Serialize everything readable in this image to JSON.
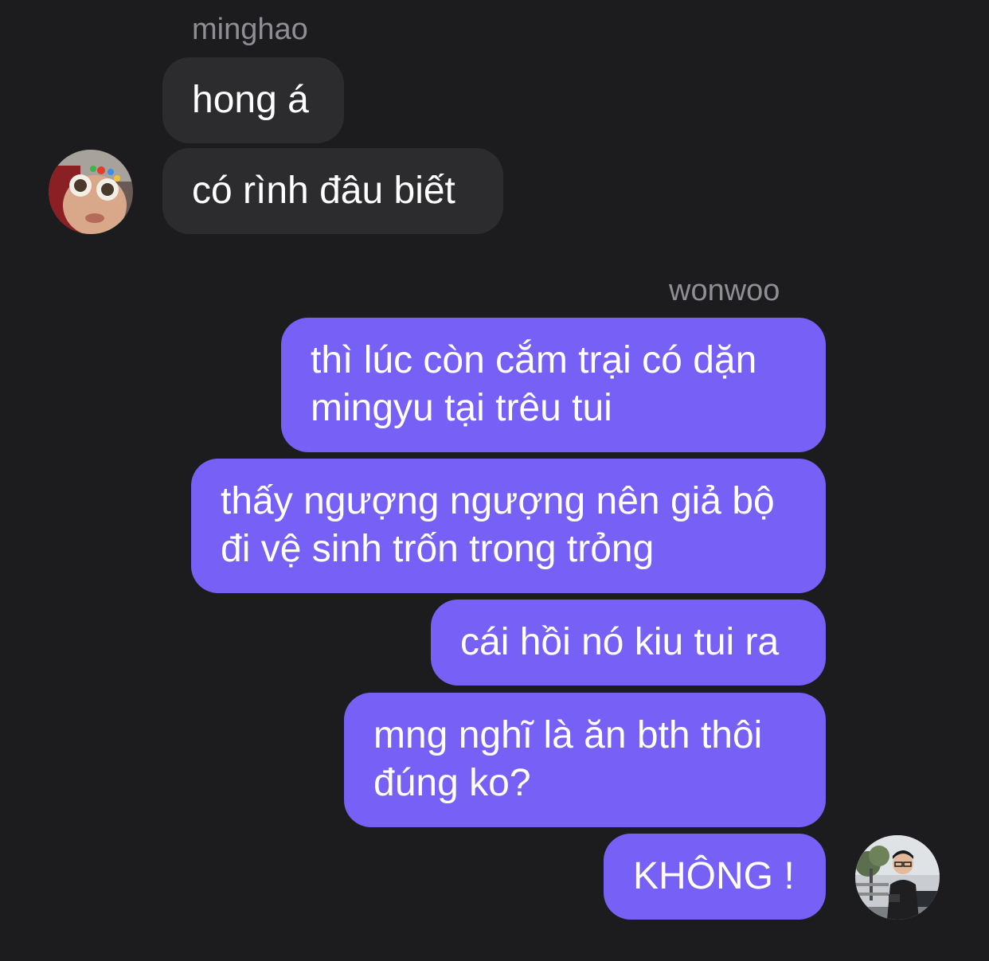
{
  "thread": {
    "incoming": {
      "sender": "minghao",
      "messages": [
        "hong á",
        "có rình đâu biết"
      ]
    },
    "outgoing": {
      "sender": "wonwoo",
      "messages": [
        "thì lúc còn cắm trại có dặn mingyu tại trêu tui",
        "thấy ngượng ngượng nên giả bộ đi vệ sinh trốn trong trỏng",
        "cái hồi nó kiu tui ra",
        "mng nghĩ là ăn bth thôi đúng ko?",
        "KHÔNG !"
      ]
    }
  },
  "colors": {
    "background": "#1c1c1e",
    "incoming_bubble": "#2c2c2e",
    "outgoing_bubble": "#7760f5",
    "sender_name": "#8e8e93",
    "text": "#ffffff"
  },
  "avatars": {
    "incoming": "avatar-photo-minghao",
    "outgoing": "avatar-photo-wonwoo"
  }
}
